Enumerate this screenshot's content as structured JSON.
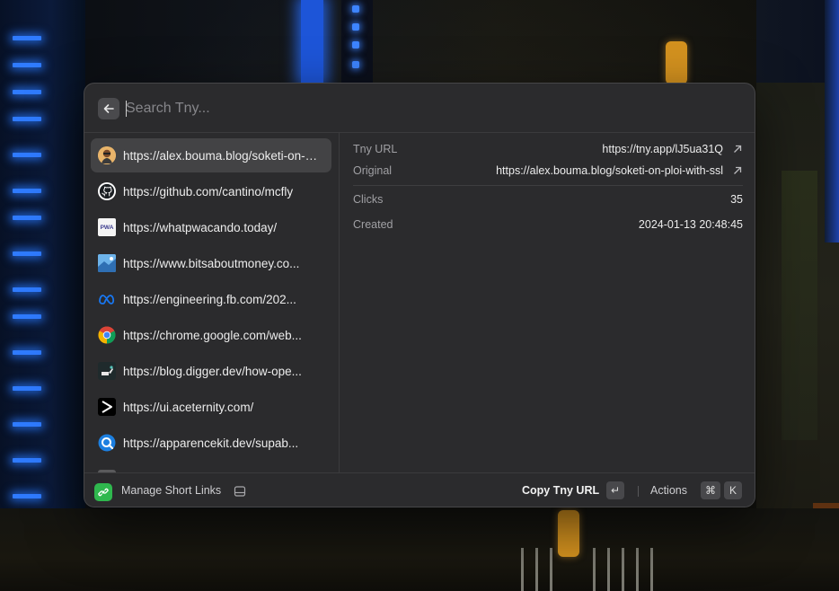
{
  "search": {
    "placeholder": "Search Tny..."
  },
  "links": [
    {
      "url": "https://alex.bouma.blog/soketi-on-ploi-with-ssl",
      "favicon": "avatar-icon",
      "selected": true
    },
    {
      "url": "https://github.com/cantino/mcfly",
      "favicon": "github-icon"
    },
    {
      "url": "https://whatpwacando.today/",
      "favicon": "pwa-icon",
      "favicon_text": "PWA"
    },
    {
      "url": "https://www.bitsaboutmoney.co...",
      "favicon": "bitsaboutmoney-icon"
    },
    {
      "url": "https://engineering.fb.com/202...",
      "favicon": "meta-icon"
    },
    {
      "url": "https://chrome.google.com/web...",
      "favicon": "chrome-icon"
    },
    {
      "url": "https://blog.digger.dev/how-ope...",
      "favicon": "digger-icon"
    },
    {
      "url": "https://ui.aceternity.com/",
      "favicon": "aceternity-icon"
    },
    {
      "url": "https://apparencekit.dev/supab...",
      "favicon": "apparencekit-icon"
    }
  ],
  "details": {
    "tny_url_label": "Tny URL",
    "tny_url_value": "https://tny.app/lJ5ua31Q",
    "original_label": "Original",
    "original_value": "https://alex.bouma.blog/soketi-on-ploi-with-ssl",
    "clicks_label": "Clicks",
    "clicks_value": "35",
    "created_label": "Created",
    "created_value": "2024-01-13 20:48:45"
  },
  "footer": {
    "app_name": "Manage Short Links",
    "primary_action": "Copy Tny URL",
    "primary_key": "↵",
    "actions_label": "Actions",
    "actions_key_1": "⌘",
    "actions_key_2": "K"
  },
  "colors": {
    "panel_bg": "#2b2b2d",
    "selected_row": "#434345",
    "app_icon_green": "#2fb84e"
  }
}
